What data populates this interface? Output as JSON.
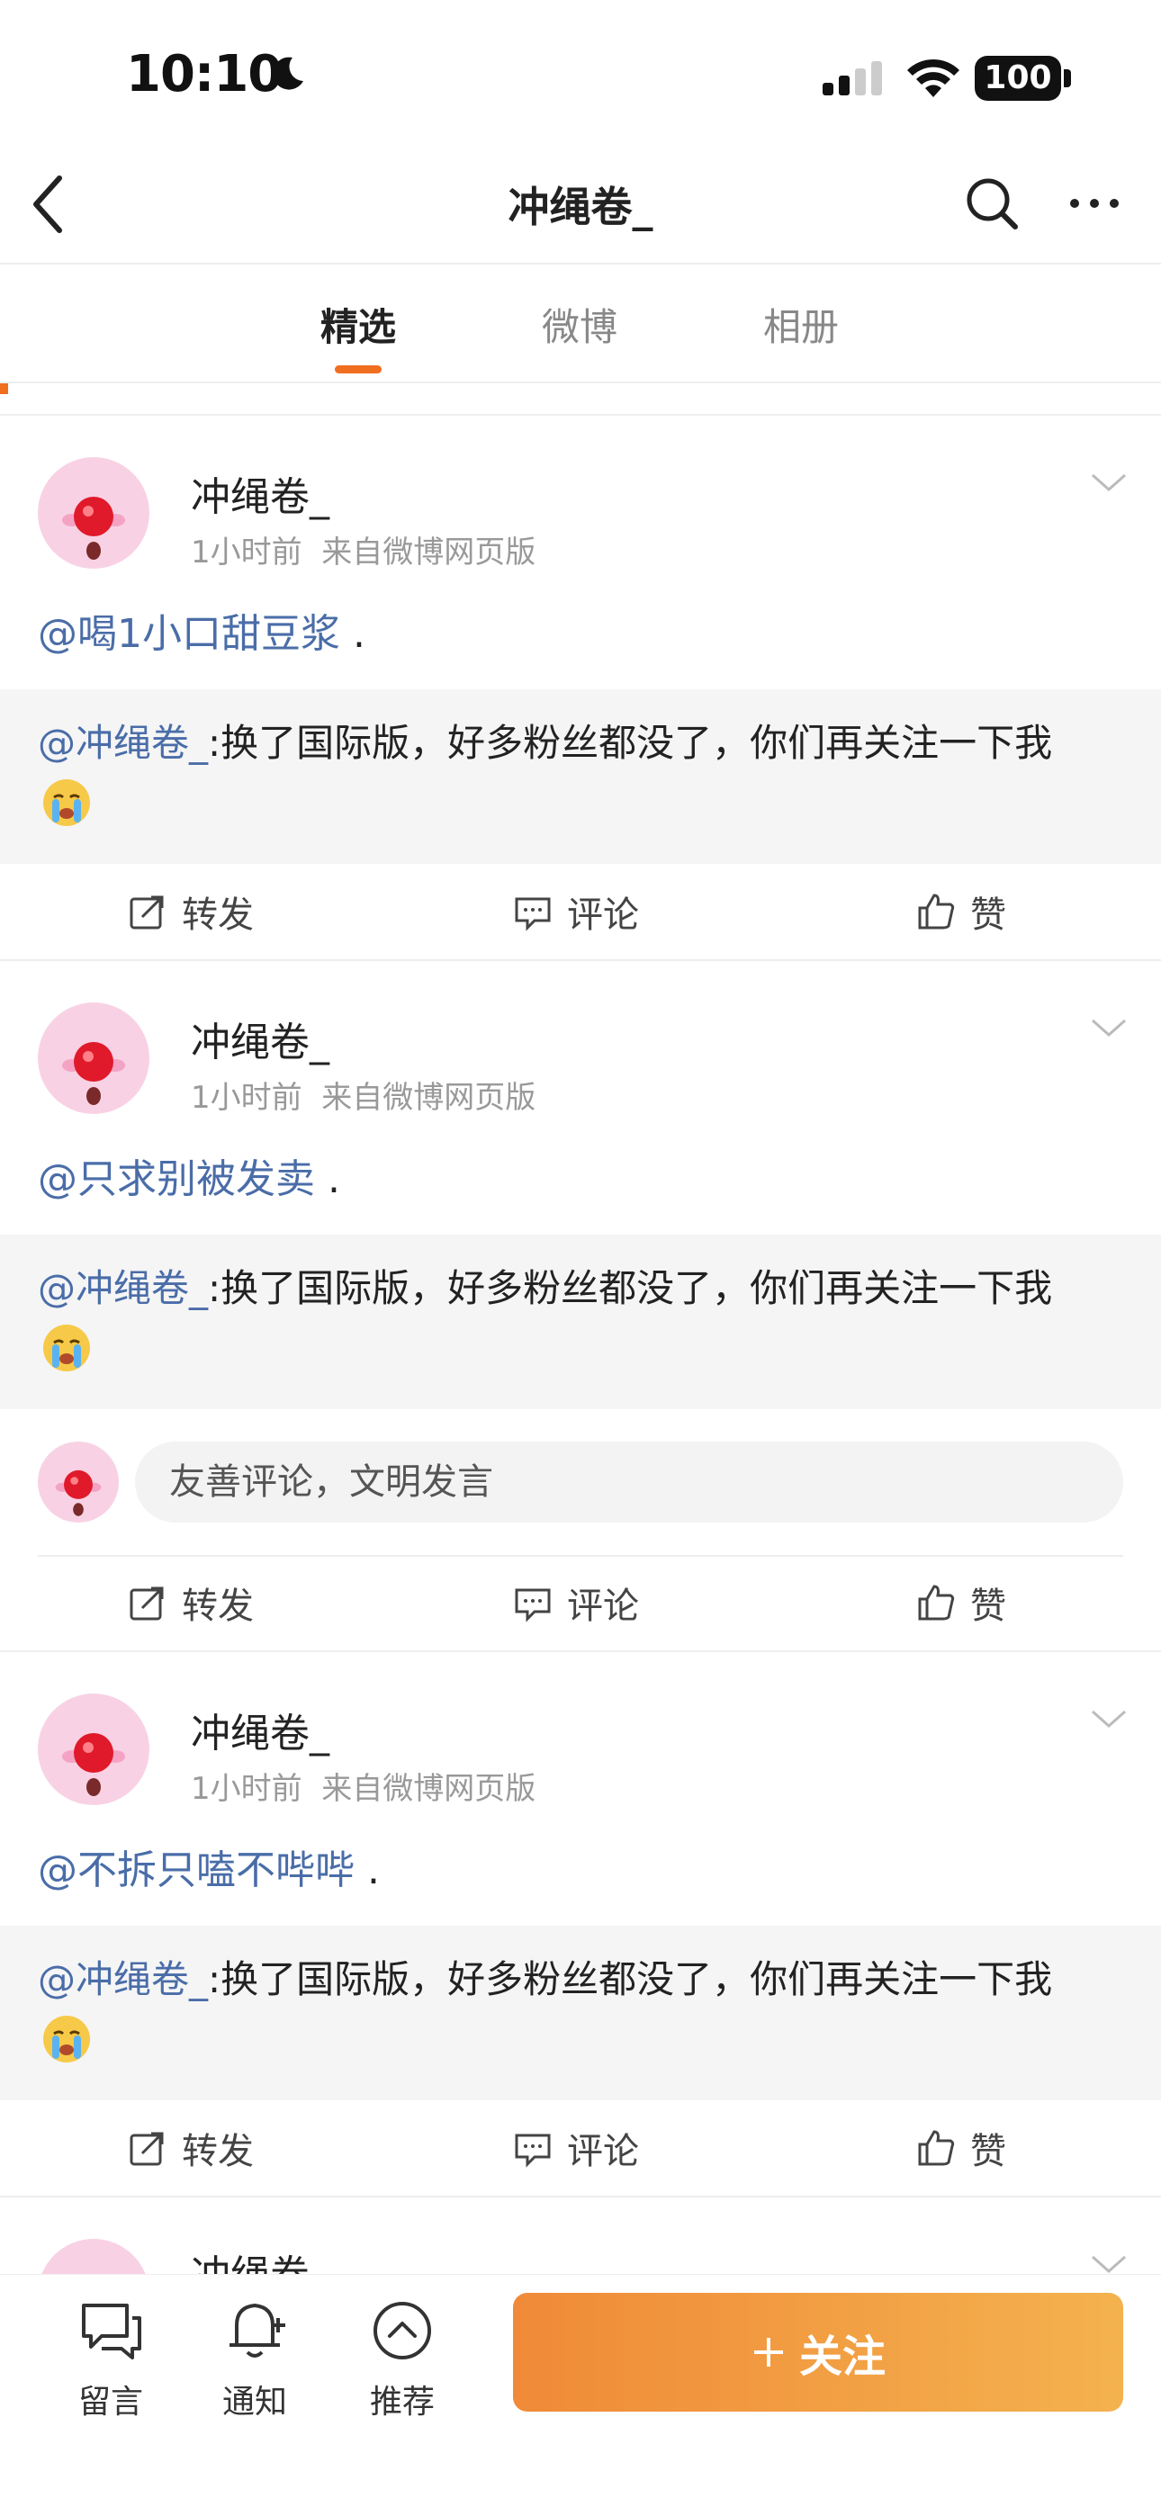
{
  "status_bar": {
    "time": "10:10",
    "battery": "100"
  },
  "header": {
    "title": "冲绳卷_"
  },
  "tabs": [
    {
      "label": "精选"
    },
    {
      "label": "微博"
    },
    {
      "label": "相册"
    }
  ],
  "posts": [
    {
      "author": "冲绳卷_",
      "time": "1小时前",
      "source": "来自微博网页版",
      "mention": "@喝1小口甜豆浆",
      "suffix": ".",
      "quote_author": "@冲绳卷_",
      "quote_text": ":换了国际版，好多粉丝都没了，你们再关注一下我"
    },
    {
      "author": "冲绳卷_",
      "time": "1小时前",
      "source": "来自微博网页版",
      "mention": "@只求别被发卖",
      "suffix": ".",
      "quote_author": "@冲绳卷_",
      "quote_text": ":换了国际版，好多粉丝都没了，你们再关注一下我"
    },
    {
      "author": "冲绳卷_",
      "time": "1小时前",
      "source": "来自微博网页版",
      "mention": "@不拆只嗑不哔哔",
      "suffix": ".",
      "quote_author": "@冲绳卷_",
      "quote_text": ":换了国际版，好多粉丝都没了，你们再关注一下我"
    },
    {
      "author": "冲绳卷"
    }
  ],
  "comment_placeholder": "友善评论，文明发言",
  "actions": {
    "repost": "转发",
    "comment": "评论",
    "like": "赞"
  },
  "bottom_bar": {
    "message": "留言",
    "notify": "通知",
    "recommend": "推荐",
    "follow": "关注"
  },
  "colors": {
    "accent": "#f06e1f",
    "link": "#4a6da8",
    "follow_start": "#f08a38",
    "follow_end": "#f4b24e"
  }
}
